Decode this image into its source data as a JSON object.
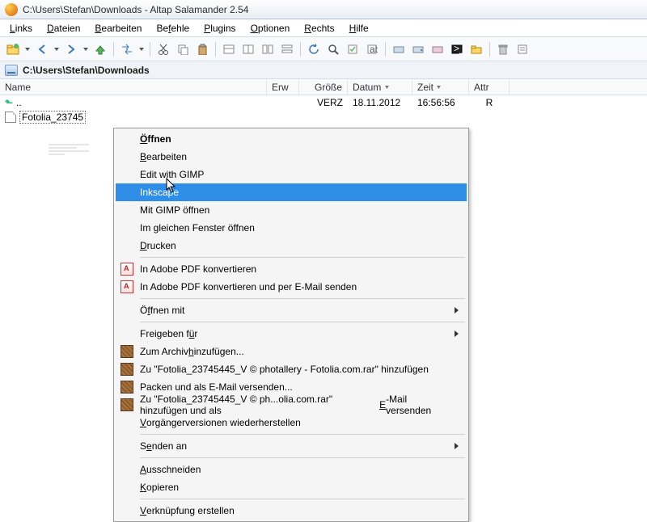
{
  "window": {
    "title": "C:\\Users\\Stefan\\Downloads - Altap Salamander 2.54"
  },
  "menu": {
    "links": "Links",
    "dateien": "Dateien",
    "bearbeiten": "Bearbeiten",
    "befehle": "Befehle",
    "plugins": "Plugins",
    "optionen": "Optionen",
    "rechts": "Rechts",
    "hilfe": "Hilfe"
  },
  "path": {
    "text": "C:\\Users\\Stefan\\Downloads"
  },
  "columns": {
    "name": "Name",
    "ext": "Erw",
    "size": "Größe",
    "date": "Datum",
    "time": "Zeit",
    "attr": "Attr"
  },
  "rows": {
    "up": {
      "name": "..",
      "size": "VERZ",
      "date": "18.11.2012",
      "time": "16:56:56",
      "attr": "R"
    },
    "file1": {
      "name": "Fotolia_23745"
    }
  },
  "context": {
    "open": "Öffnen",
    "edit": "Bearbeiten",
    "edit_gimp": "Edit with GIMP",
    "inkscape": "Inkscape",
    "mit_gimp": "Mit GIMP öffnen",
    "same_window": "Im gleichen Fenster öffnen",
    "print": "Drucken",
    "pdf_convert": "In Adobe PDF konvertieren",
    "pdf_convert_mail": "In Adobe PDF konvertieren und per E-Mail senden",
    "open_with": "Öffnen mit",
    "share": "Freigeben für",
    "add_archive": "Zum Archiv hinzufügen...",
    "add_named": "Zu \"Fotolia_23745445_V © photallery - Fotolia.com.rar\" hinzufügen",
    "pack_mail": "Packen und als E-Mail versenden...",
    "add_named_mail": "Zu \"Fotolia_23745445_V © ph...olia.com.rar\" hinzufügen und als E-Mail versenden",
    "prev_versions": "Vorgängerversionen wiederherstellen",
    "send_to": "Senden an",
    "cut": "Ausschneiden",
    "copy": "Kopieren",
    "link": "Verknüpfung erstellen"
  }
}
